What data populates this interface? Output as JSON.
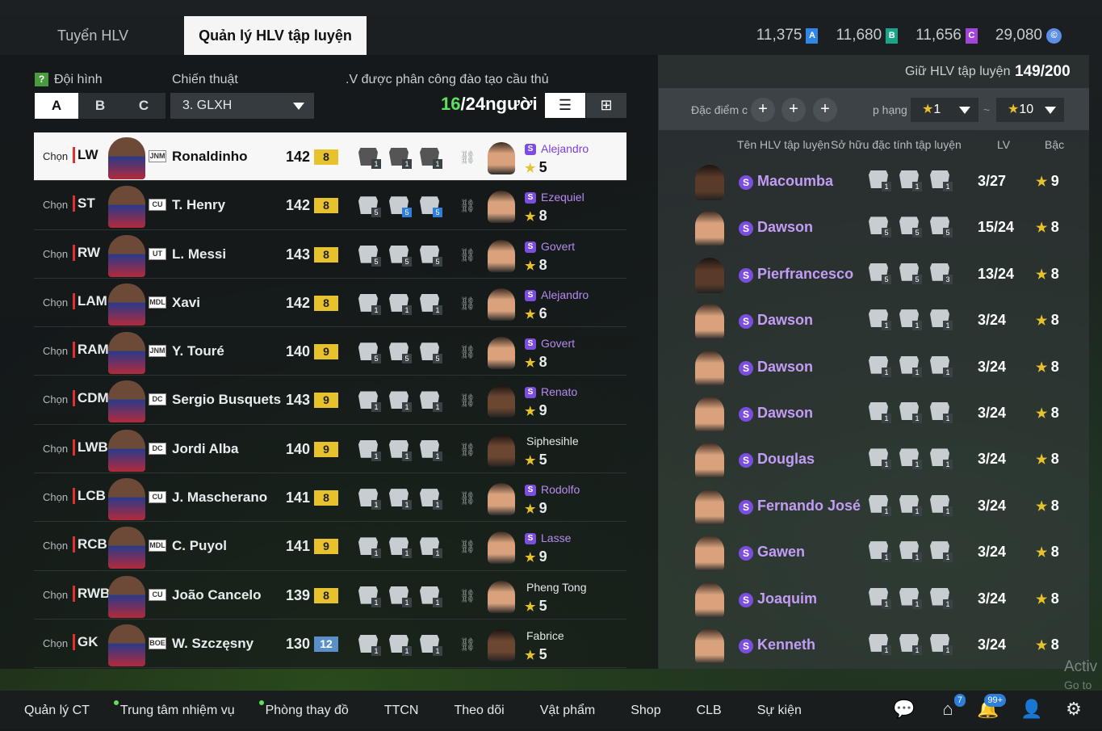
{
  "tabs": {
    "recruit": "Tuyển HLV",
    "manage": "Quản lý HLV tập luyện"
  },
  "currencies": [
    {
      "value": "11,375",
      "icon": "A",
      "color": "#2f86e6"
    },
    {
      "value": "11,680",
      "icon": "B",
      "color": "#1aa58a"
    },
    {
      "value": "11,656",
      "icon": "C",
      "color": "#a345d8"
    },
    {
      "value": "29,080",
      "icon": "©",
      "color": "#5b8fe8"
    }
  ],
  "left": {
    "formation_label": "Đội hình",
    "tactic_label": "Chiến thuật",
    "assigned_label": ".V được phân công đào tạo cầu thủ",
    "formation_options": [
      "A",
      "B",
      "C"
    ],
    "formation_selected": "A",
    "tactic_value": "3. GLXH",
    "count_current": "16",
    "count_rest": "/24người",
    "choose_label": "Chọn"
  },
  "players": [
    {
      "pos": "LW",
      "season": "JNM",
      "name": "Ronaldinho",
      "ovr": "142",
      "grade": "8",
      "traits": [
        "1",
        "1",
        "1"
      ],
      "coach": "Alejandro",
      "coach_s": true,
      "stars": "5"
    },
    {
      "pos": "ST",
      "season": "CU",
      "name": "T. Henry",
      "ovr": "142",
      "grade": "8",
      "traits": [
        "5",
        "5",
        "5"
      ],
      "coach": "Ezequiel",
      "coach_s": true,
      "stars": "8"
    },
    {
      "pos": "RW",
      "season": "UT",
      "name": "L. Messi",
      "ovr": "143",
      "grade": "8",
      "traits": [
        "5",
        "5",
        "5"
      ],
      "coach": "Govert",
      "coach_s": true,
      "stars": "8"
    },
    {
      "pos": "LAM",
      "season": "MDL",
      "name": "Xavi",
      "ovr": "142",
      "grade": "8",
      "traits": [
        "1",
        "1",
        "1"
      ],
      "coach": "Alejandro",
      "coach_s": true,
      "stars": "6"
    },
    {
      "pos": "RAM",
      "season": "JNM",
      "name": "Y. Touré",
      "ovr": "140",
      "grade": "9",
      "traits": [
        "5",
        "5",
        "5"
      ],
      "coach": "Govert",
      "coach_s": true,
      "stars": "8"
    },
    {
      "pos": "CDM",
      "season": "DC",
      "name": "Sergio Busquets",
      "ovr": "143",
      "grade": "9",
      "traits": [
        "1",
        "1",
        "1"
      ],
      "coach": "Renato",
      "coach_s": true,
      "stars": "9"
    },
    {
      "pos": "LWB",
      "season": "DC",
      "name": "Jordi Alba",
      "ovr": "140",
      "grade": "9",
      "traits": [
        "1",
        "1",
        "1"
      ],
      "coach": "Siphesihle",
      "coach_s": false,
      "stars": "5"
    },
    {
      "pos": "LCB",
      "season": "CU",
      "name": "J. Mascherano",
      "ovr": "141",
      "grade": "8",
      "traits": [
        "1",
        "1",
        "1"
      ],
      "coach": "Rodolfo",
      "coach_s": true,
      "stars": "9"
    },
    {
      "pos": "RCB",
      "season": "MDL",
      "name": "C. Puyol",
      "ovr": "141",
      "grade": "9",
      "traits": [
        "1",
        "1",
        "1"
      ],
      "coach": "Lasse",
      "coach_s": true,
      "stars": "9"
    },
    {
      "pos": "RWB",
      "season": "CU",
      "name": "João Cancelo",
      "ovr": "139",
      "grade": "8",
      "traits": [
        "1",
        "1",
        "1"
      ],
      "coach": "Pheng Tong",
      "coach_s": false,
      "stars": "5"
    },
    {
      "pos": "GK",
      "season": "BOE",
      "name": "W. Szczęsny",
      "ovr": "130",
      "grade": "12",
      "traits": [
        "1",
        "1",
        "1"
      ],
      "coach": "Fabrice",
      "coach_s": false,
      "stars": "5"
    }
  ],
  "right": {
    "keep_label": "Giữ HLV tập luyện",
    "keep_value": "149/200",
    "trait_filter_label": "Đặc điểm c",
    "rank_label": "p hạng",
    "rank_min": "1",
    "rank_max": "10",
    "tilde": "~",
    "col_name": "Tên HLV tập luyện",
    "col_traits": "Sở hữu đặc tính tập luyện",
    "col_lv": "LV",
    "col_grade": "Bậc"
  },
  "coaches": [
    {
      "name": "Macoumba",
      "traits": [
        "1",
        "1",
        "1"
      ],
      "lv": "3/27",
      "grade": "9",
      "dark": true
    },
    {
      "name": "Dawson",
      "traits": [
        "5",
        "5",
        "5"
      ],
      "lv": "15/24",
      "grade": "8",
      "dark": false
    },
    {
      "name": "Pierfrancesco",
      "traits": [
        "5",
        "5",
        "3"
      ],
      "lv": "13/24",
      "grade": "8",
      "dark": true
    },
    {
      "name": "Dawson",
      "traits": [
        "1",
        "1",
        "1"
      ],
      "lv": "3/24",
      "grade": "8",
      "dark": false
    },
    {
      "name": "Dawson",
      "traits": [
        "1",
        "1",
        "1"
      ],
      "lv": "3/24",
      "grade": "8",
      "dark": false
    },
    {
      "name": "Dawson",
      "traits": [
        "1",
        "1",
        "1"
      ],
      "lv": "3/24",
      "grade": "8",
      "dark": false
    },
    {
      "name": "Douglas",
      "traits": [
        "1",
        "1",
        "1"
      ],
      "lv": "3/24",
      "grade": "8",
      "dark": false
    },
    {
      "name": "Fernando José",
      "traits": [
        "1",
        "1",
        "1"
      ],
      "lv": "3/24",
      "grade": "8",
      "dark": false
    },
    {
      "name": "Gawen",
      "traits": [
        "1",
        "1",
        "1"
      ],
      "lv": "3/24",
      "grade": "8",
      "dark": false
    },
    {
      "name": "Joaquim",
      "traits": [
        "1",
        "1",
        "1"
      ],
      "lv": "3/24",
      "grade": "8",
      "dark": false
    },
    {
      "name": "Kenneth",
      "traits": [
        "1",
        "1",
        "1"
      ],
      "lv": "3/24",
      "grade": "8",
      "dark": false
    }
  ],
  "bottom_nav": [
    {
      "label": "Quản lý CT",
      "dot": false
    },
    {
      "label": "Trung tâm nhiệm vụ",
      "dot": true
    },
    {
      "label": "Phòng thay đồ",
      "dot": true
    },
    {
      "label": "TTCN",
      "dot": false
    },
    {
      "label": "Theo dõi",
      "dot": false
    },
    {
      "label": "Vật phẩm",
      "dot": false
    },
    {
      "label": "Shop",
      "dot": false
    },
    {
      "label": "CLB",
      "dot": false
    },
    {
      "label": "Sự kiện",
      "dot": false
    }
  ],
  "nav_icons": [
    {
      "name": "chat-icon",
      "badge": ""
    },
    {
      "name": "home-icon",
      "badge": "7"
    },
    {
      "name": "bell-icon",
      "badge": "99+"
    },
    {
      "name": "profile-icon",
      "badge": ""
    },
    {
      "name": "settings-icon",
      "badge": ""
    }
  ],
  "watermark": {
    "line1": "Activ",
    "line2": "Go to S"
  }
}
